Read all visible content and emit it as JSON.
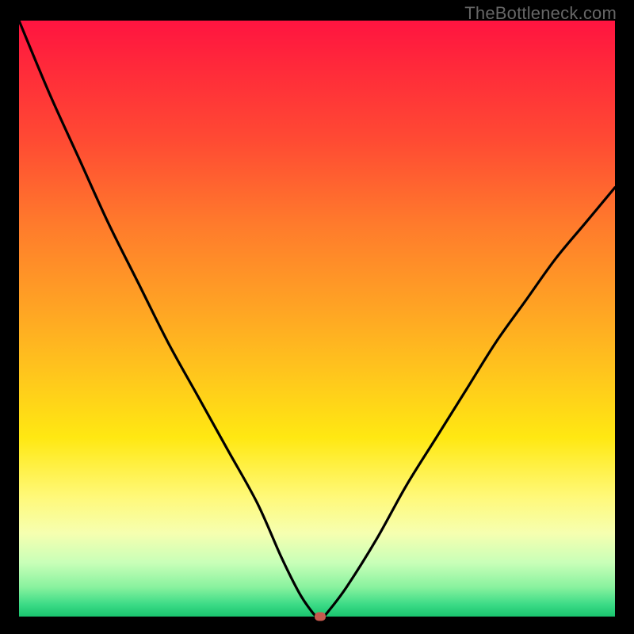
{
  "watermark": "TheBottleneck.com",
  "chart_data": {
    "type": "line",
    "title": "",
    "xlabel": "",
    "ylabel": "",
    "xlim": [
      0,
      100
    ],
    "ylim": [
      0,
      100
    ],
    "series": [
      {
        "name": "curve",
        "x": [
          0,
          5,
          10,
          15,
          20,
          25,
          30,
          35,
          40,
          44,
          47,
          49,
          50,
          51,
          52,
          55,
          60,
          65,
          70,
          75,
          80,
          85,
          90,
          95,
          100
        ],
        "y": [
          100,
          88,
          77,
          66,
          56,
          46,
          37,
          28,
          19,
          10,
          4,
          1,
          0,
          0,
          1,
          5,
          13,
          22,
          30,
          38,
          46,
          53,
          60,
          66,
          72
        ]
      }
    ],
    "marker": {
      "x": 50.5,
      "y": 0
    }
  },
  "colors": {
    "curve": "#000000",
    "marker": "#c65a4e"
  }
}
